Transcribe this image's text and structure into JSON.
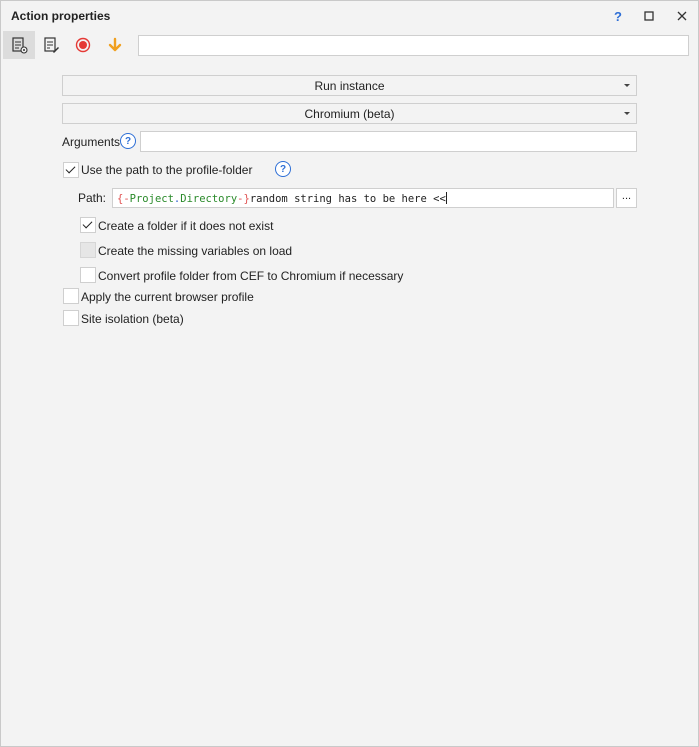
{
  "window": {
    "title": "Action properties",
    "help_label": "?"
  },
  "toolbar": {
    "tools": [
      {
        "name": "properties-tab",
        "icon": "properties-icon"
      },
      {
        "name": "edit-tab",
        "icon": "edit-document-icon"
      },
      {
        "name": "record-button",
        "icon": "record-icon"
      },
      {
        "name": "download-button",
        "icon": "arrow-down-icon"
      }
    ],
    "input_value": ""
  },
  "form": {
    "action_select": "Run instance",
    "browser_select": "Chromium (beta)",
    "arguments_label": "Arguments",
    "arguments_value": "",
    "help_symbol": "?",
    "use_profile_path": {
      "label": "Use the path to the profile-folder",
      "checked": true
    },
    "path_label": "Path:",
    "path_value": {
      "open_brace": "{-",
      "var_a": "Project",
      "dot": ".",
      "var_b": "Directory",
      "close_brace": "-}",
      "rest": "random string has to be here <<"
    },
    "browse_label": "...",
    "create_folder": {
      "label": "Create a folder if it does not exist",
      "checked": true
    },
    "create_missing_vars": {
      "label": "Create the missing variables on load",
      "checked": false,
      "disabled": true
    },
    "convert_profile": {
      "label": "Convert profile folder from CEF to Chromium if necessary",
      "checked": false
    },
    "apply_profile": {
      "label": "Apply the current browser profile",
      "checked": false
    },
    "site_isolation": {
      "label": "Site isolation (beta)",
      "checked": false
    }
  },
  "colors": {
    "accent": "#2e6fd6",
    "record": "#e53935",
    "arrow": "#f0a020"
  }
}
